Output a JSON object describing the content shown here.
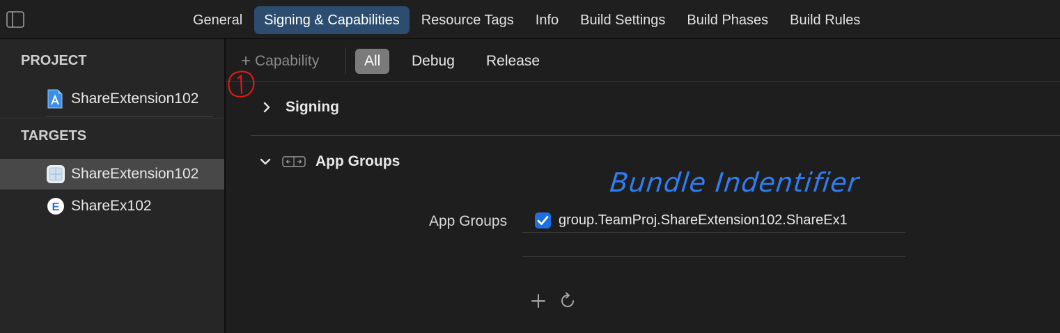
{
  "tabs": [
    {
      "label": "General"
    },
    {
      "label": "Signing & Capabilities"
    },
    {
      "label": "Resource Tags"
    },
    {
      "label": "Info"
    },
    {
      "label": "Build Settings"
    },
    {
      "label": "Build Phases"
    },
    {
      "label": "Build Rules"
    }
  ],
  "navigator": {
    "project_header": "PROJECT",
    "project_item": "ShareExtension102",
    "targets_header": "TARGETS",
    "targets": [
      {
        "label": "ShareExtension102",
        "selected": true
      },
      {
        "label": "ShareEx102",
        "icon_letter": "E"
      }
    ]
  },
  "capability_bar": {
    "add_capability": "Capability",
    "filters": [
      "All",
      "Debug",
      "Release"
    ],
    "active_filter": "All"
  },
  "sections": {
    "signing": "Signing",
    "app_groups": "App Groups"
  },
  "app_groups": {
    "field_label": "App Groups",
    "entries": [
      {
        "value": "group.TeamProj.ShareExtension102.ShareEx1",
        "checked": true
      }
    ]
  },
  "annotations": {
    "handwritten_note": "Bundle Indentifier",
    "red_mark": "1"
  },
  "colors": {
    "accent_tab": "#2c4d6f",
    "checkbox": "#1e6fe0",
    "annotation_blue": "#2f7df0",
    "annotation_red": "#e01818"
  }
}
